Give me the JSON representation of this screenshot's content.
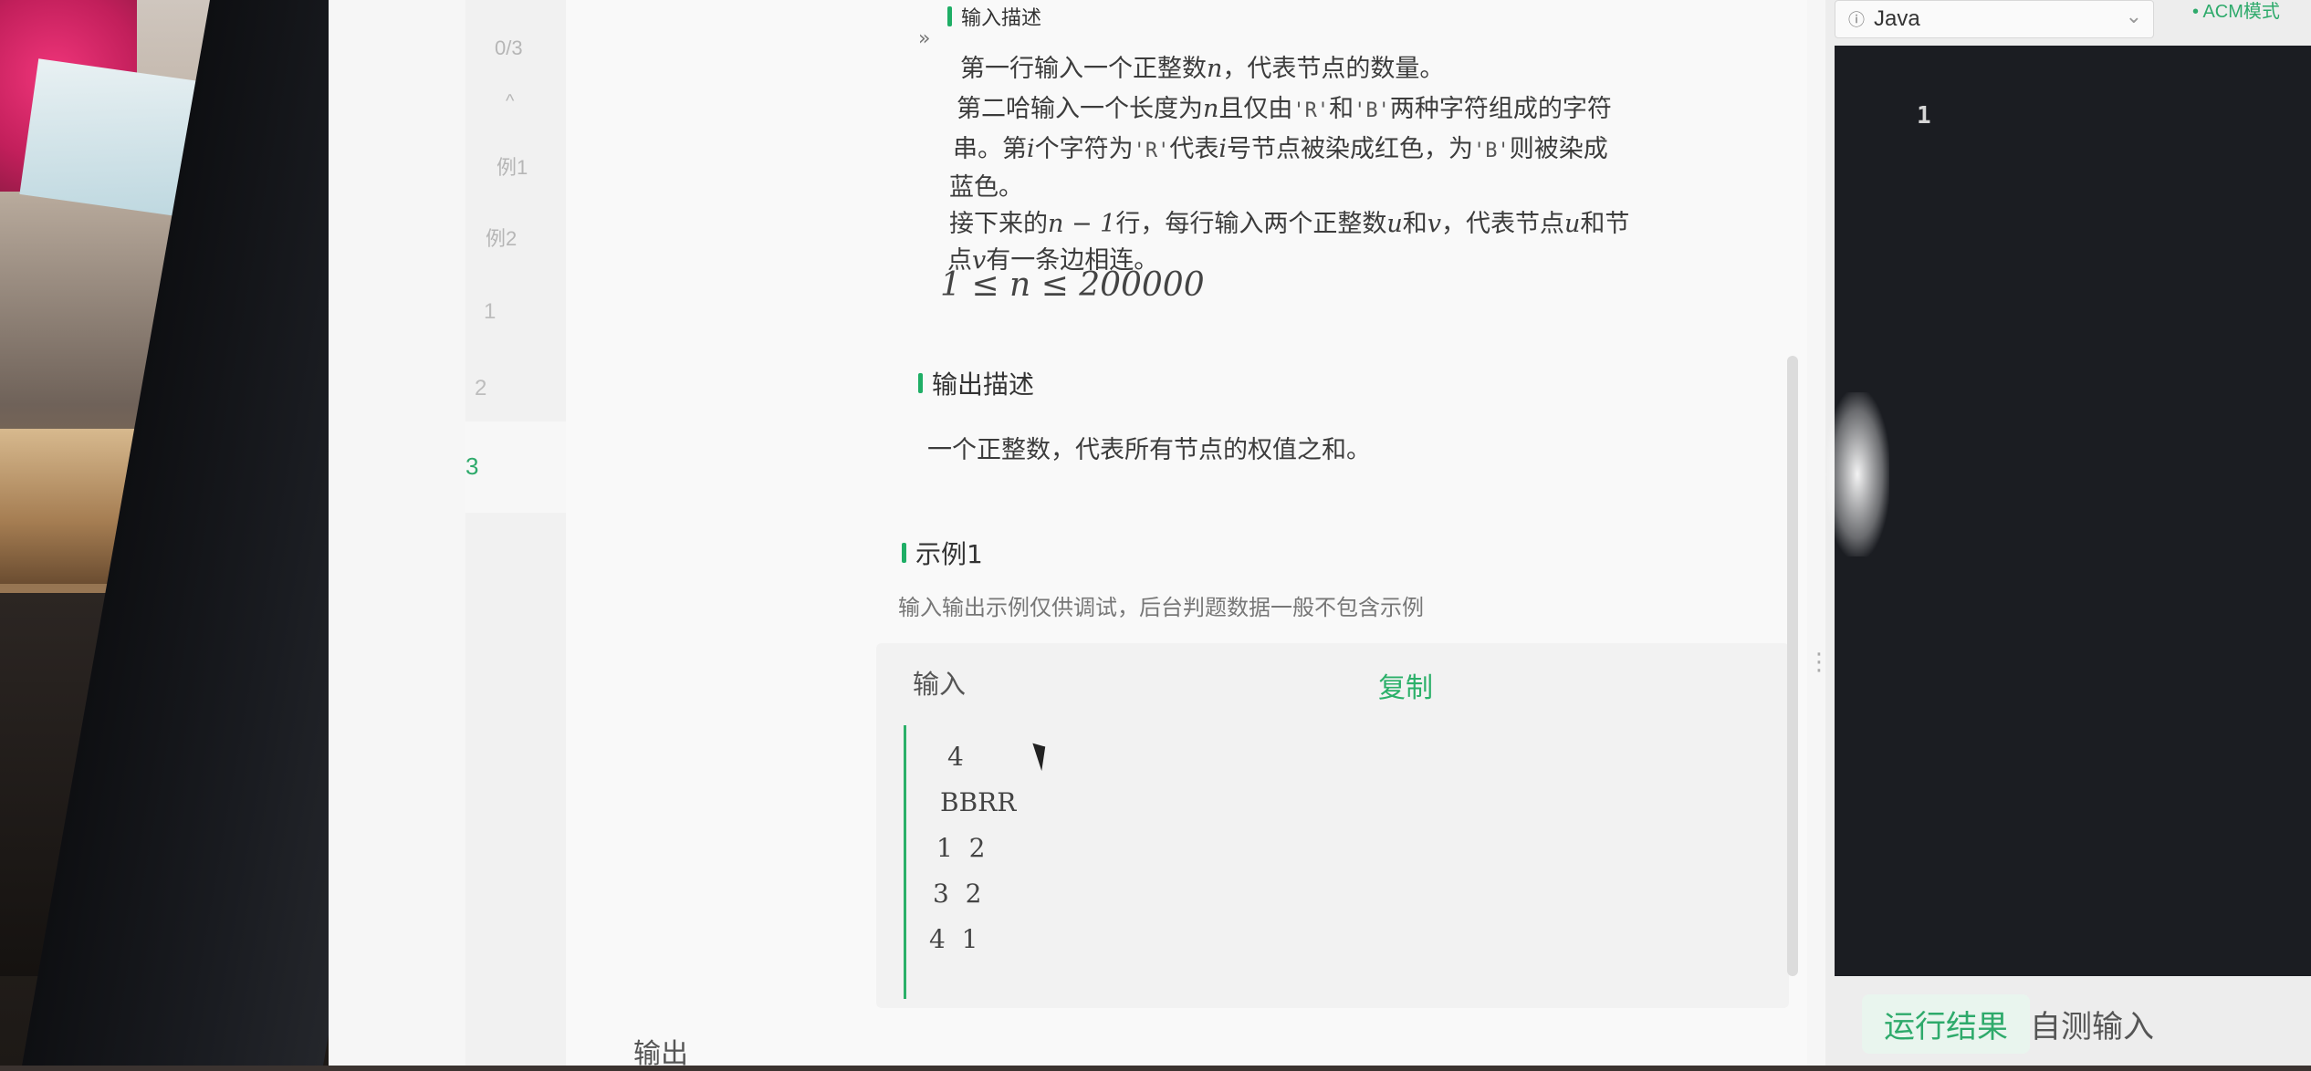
{
  "rail": {
    "progress": "0/3",
    "example1": "例1",
    "example2": "例2",
    "lines": [
      "1",
      "2",
      "3"
    ]
  },
  "problem": {
    "collapse_glyph": "»",
    "input_heading": "输入描述",
    "input_line1_pre": "第一行输入一个正整数",
    "input_line1_var": "n",
    "input_line1_post": "，代表节点的数量。",
    "input_line2_pre": "第二哈输入一个长度为",
    "input_line2_var": "n",
    "input_line2_mid": "且仅由",
    "input_line2_r": "'R'",
    "input_line2_and": "和",
    "input_line2_b": "'B'",
    "input_line2_post": "两种字符组成的字符",
    "input_line3_pre": "串。第",
    "input_line3_var": "i",
    "input_line3_mid": "个字符为",
    "input_line3_r": "'R'",
    "input_line3_mid2": "代表",
    "input_line3_var2": "i",
    "input_line3_post": "号节点被染成红色，为",
    "input_line3_b": "'B'",
    "input_line3_end": "则被染成",
    "input_line4": "蓝色。",
    "input_line5_pre": "接下来的",
    "input_line5_var": "n − 1",
    "input_line5_mid": "行，每行输入两个正整数",
    "input_line5_u": "u",
    "input_line5_and": "和",
    "input_line5_v": "v",
    "input_line5_mid2": "，代表节点",
    "input_line5_u2": "u",
    "input_line5_post": "和节",
    "input_line6_pre": "点",
    "input_line6_v": "v",
    "input_line6_post": "有一条边相连。",
    "constraint": "1 ≤ n ≤ 200000",
    "output_heading": "输出描述",
    "output_text": "一个正整数，代表所有节点的权值之和。",
    "example_heading": "示例1",
    "example_hint": "输入输出示例仅供调试，后台判题数据一般不包含示例",
    "example_input_label": "输入",
    "copy_label": "复制",
    "example_input_lines": [
      "4",
      "BBRR",
      "1  2",
      "3  2",
      "4  1"
    ],
    "output_label": "输出"
  },
  "editor": {
    "language": "Java",
    "mode": "• ACM模式",
    "line_number": "1",
    "tab_result": "运行结果",
    "tab_custom_input": "自测输入"
  },
  "colors": {
    "accent": "#2eaa6b",
    "editor_bg": "#1b1d22"
  }
}
